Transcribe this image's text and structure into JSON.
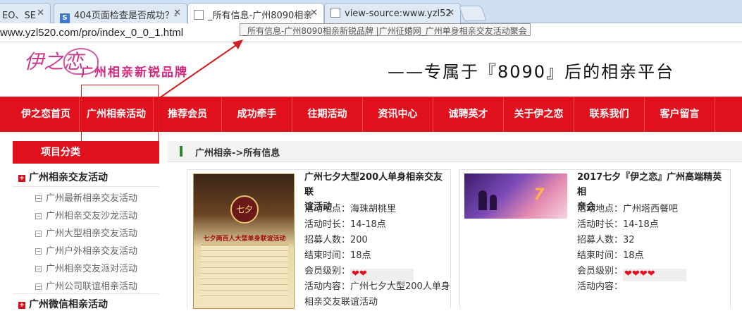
{
  "browser": {
    "tabs": [
      {
        "label": "EO、SE",
        "icon": "page-icon"
      },
      {
        "label": "404页面检查是否成功？-",
        "icon": "s-icon"
      },
      {
        "label": "_所有信息-广州8090相亲",
        "icon": "page-icon"
      },
      {
        "label": "view-source:www.yzl52",
        "icon": "page-icon"
      }
    ],
    "url": "www.yzl520.com/pro/index_0_0_1.html",
    "tooltip": "_所有信息-广州8090相亲新锐品牌 |广州征婚网_广州单身相亲交友活动聚会"
  },
  "header": {
    "logo_script": "伊之恋",
    "logo_text": "广州相亲新锐品牌",
    "slogan": "——专属于『8090』后的相亲平台"
  },
  "nav": [
    "伊之恋首页",
    "广州相亲活动",
    "推荐会员",
    "成功牵手",
    "往期活动",
    "资讯中心",
    "诚聘英才",
    "关于伊之恋",
    "联系我们",
    "客户留言"
  ],
  "sidebar": {
    "heading": "项目分类",
    "section1": "广州相亲交友活动",
    "items": [
      "广州最新相亲交友活动",
      "广州相亲交友沙龙活动",
      "广州大型相亲交友活动",
      "广州户外相亲交友活动",
      "广州相亲交友派对活动",
      "广州公司联谊相亲活动"
    ],
    "section2": "广州微信相亲活动"
  },
  "breadcrumb": "广州相亲->所有信息",
  "cards": [
    {
      "title_line1": "广州七夕大型200人单身相亲交友联",
      "title_line2": "谊活动",
      "location": "活动地点：海珠胡桃里",
      "duration": "活动时长：14-18点",
      "recruit": "招募人数：200",
      "end": "结束时间：18点",
      "level_label": "会员级别：",
      "hearts": "❤❤",
      "content_line1": "活动内容：广州七夕大型200人单身",
      "content_line2": "相亲交友联谊活动",
      "poster_title": "七夕",
      "poster_sub": "七夕两百人大型单身联谊活动"
    },
    {
      "title_line1": "2017七夕『伊之恋』广州高端精英相",
      "title_line2": "亲会",
      "location": "活动地点：广州塔西餐吧",
      "duration": "活动时长：14-18点",
      "recruit": "招募人数：32",
      "end": "结束时间：18点",
      "level_label": "会员级别：",
      "hearts": "❤❤❤❤",
      "content_line1": "活动内容："
    }
  ],
  "colors": {
    "nav_red": "#e0101c",
    "accent_pink": "#d4287f"
  }
}
